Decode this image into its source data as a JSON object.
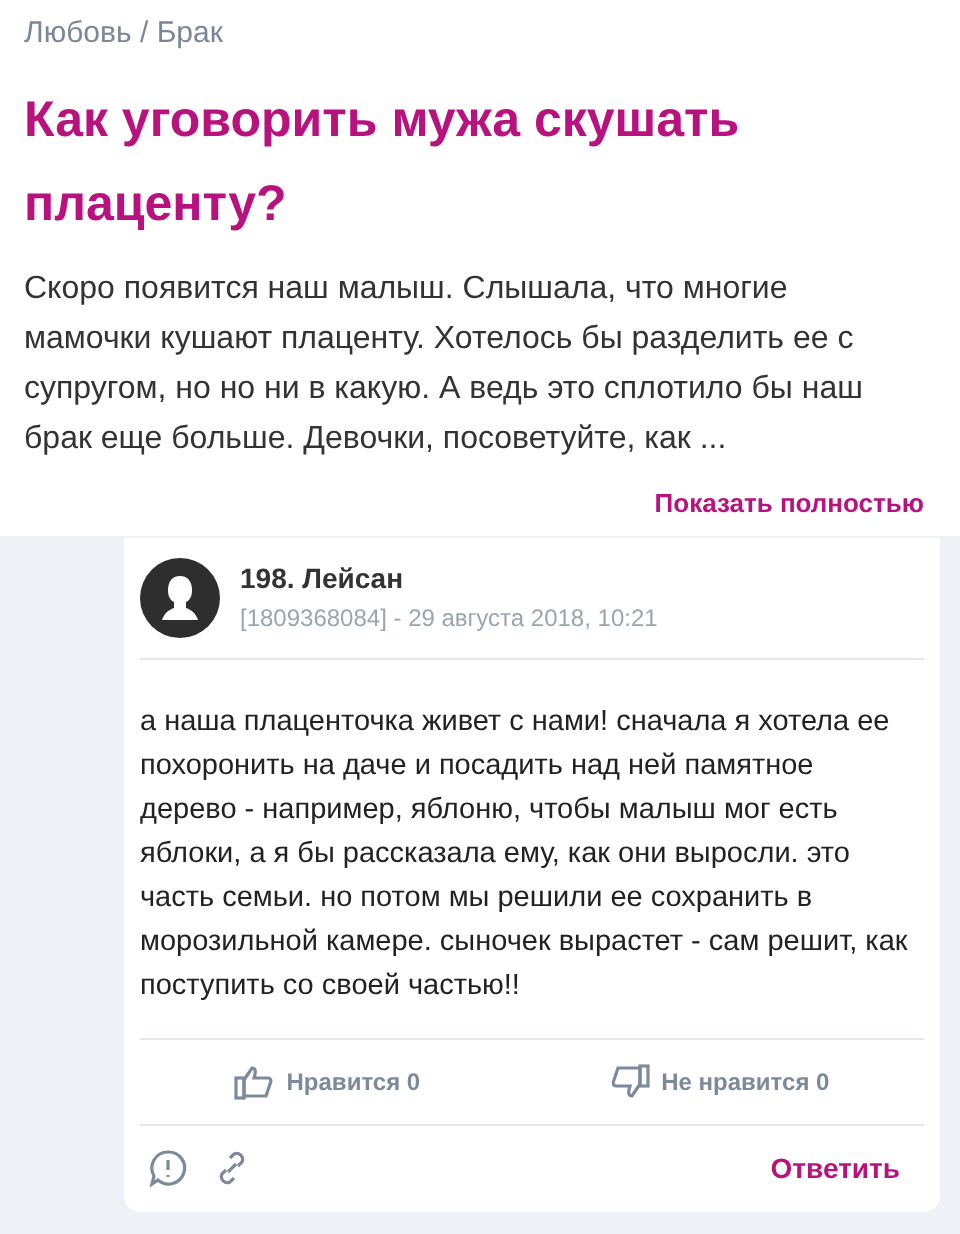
{
  "breadcrumb": "Любовь / Брак",
  "question": {
    "title": "Как уговорить мужа скушать плаценту?",
    "text": "Скоро появится наш малыш. Слышала, что многие мамочки кушают плаценту. Хотелось бы разделить ее с супругом, но но ни в какую. А ведь это сплотило бы наш брак еще больше. Девочки, посоветуйте, как ...",
    "show_full": "Показать полностью"
  },
  "comment": {
    "author": "198. Лейсан",
    "meta": "[1809368084] - 29 августа 2018, 10:21",
    "text": "а наша плаценточка живет с нами! сначала я хотела ее похоронить на даче и посадить над ней памятное дерево - например, яблоню, чтобы малыш мог есть яблоки, а я бы рассказала ему, как они выросли. это часть семьи. но потом мы решили ее сохранить в морозильной камере. сыночек вырастет - сам решит, как поступить со своей частью!!",
    "like": "Нравится 0",
    "dislike": "Не нравится 0",
    "reply": "Ответить"
  }
}
